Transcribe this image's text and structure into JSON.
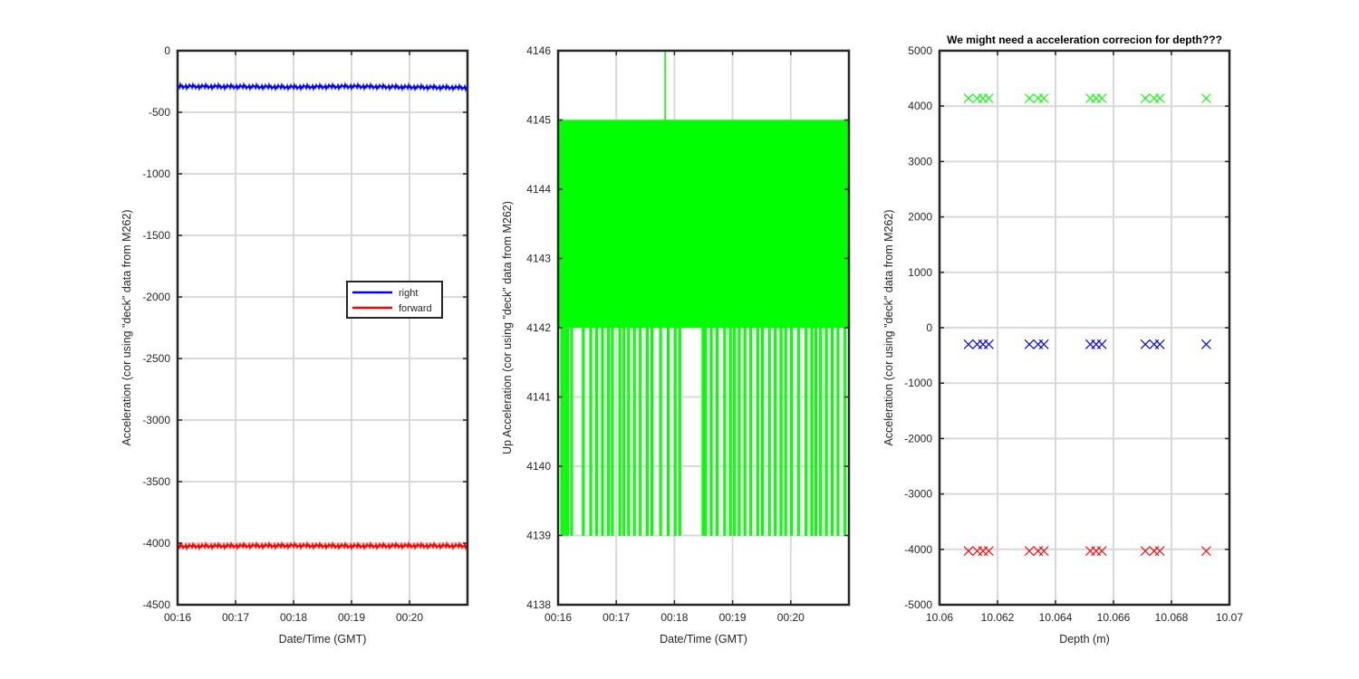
{
  "chart_data": [
    {
      "type": "line",
      "title": "",
      "xlabel": "Date/Time (GMT)",
      "ylabel": "Acceleration (cor using \"deck\" data from M262)",
      "x_tick_labels": [
        "00:16",
        "00:17",
        "00:18",
        "00:19",
        "00:20"
      ],
      "xlim_minutes": [
        16,
        21
      ],
      "x_ticks_minutes": [
        16,
        17,
        18,
        19,
        20
      ],
      "ylim": [
        -4500,
        0
      ],
      "y_ticks": [
        0,
        -500,
        -1000,
        -1500,
        -2000,
        -2500,
        -3000,
        -3500,
        -4000,
        -4500
      ],
      "grid": true,
      "legend": {
        "placement": "center-right",
        "entries": [
          "right",
          "forward"
        ]
      },
      "series": [
        {
          "name": "right",
          "color": "#0000ff",
          "x_minutes": [
            16,
            17,
            18,
            19,
            20,
            21
          ],
          "values": [
            -290,
            -292,
            -295,
            -290,
            -296,
            -300
          ]
        },
        {
          "name": "forward",
          "color": "#ff0000",
          "x_minutes": [
            16,
            17,
            18,
            19,
            20,
            21
          ],
          "values": [
            -4025,
            -4022,
            -4020,
            -4023,
            -4021,
            -4022
          ]
        }
      ]
    },
    {
      "type": "line",
      "title": "",
      "xlabel": "Date/Time (GMT)",
      "ylabel": "Up Acceleration (cor using \"deck\" data from M262)",
      "x_tick_labels": [
        "00:16",
        "00:17",
        "00:18",
        "00:19",
        "00:20"
      ],
      "xlim_minutes": [
        16,
        21
      ],
      "x_ticks_minutes": [
        16,
        17,
        18,
        19,
        20
      ],
      "ylim": [
        4138,
        4146
      ],
      "y_ticks": [
        4138,
        4139,
        4140,
        4141,
        4142,
        4143,
        4144,
        4145,
        4146
      ],
      "grid": true,
      "series": [
        {
          "name": "",
          "color": "#00ff00",
          "range_values": [
            4142,
            4145
          ],
          "high_spikes": [
            17.84
          ],
          "low_spikes": [
            16.05,
            16.1,
            16.15,
            16.22,
            16.42,
            16.55,
            16.65,
            16.75,
            16.85,
            16.92,
            17.05,
            17.12,
            17.2,
            17.3,
            17.4,
            17.52,
            17.6,
            17.75,
            17.88,
            18.0,
            18.08,
            18.48,
            18.52,
            18.62,
            18.72,
            18.85,
            18.95,
            19.02,
            19.1,
            19.2,
            19.3,
            19.42,
            19.5,
            19.62,
            19.72,
            19.82,
            19.9,
            20.0,
            20.12,
            20.25,
            20.35,
            20.42,
            20.5,
            20.6,
            20.7,
            20.8,
            20.92
          ]
        }
      ]
    },
    {
      "type": "scatter",
      "title": "We might need a acceleration correcion for depth???",
      "xlabel": "Depth (m)",
      "ylabel": "Acceleration (cor using \"deck\" data from M262)",
      "x_tick_labels": [
        "10.06",
        "10.062",
        "10.064",
        "10.066",
        "10.068",
        "10.07"
      ],
      "xlim": [
        10.06,
        10.07
      ],
      "x_ticks": [
        10.06,
        10.062,
        10.064,
        10.066,
        10.068,
        10.07
      ],
      "ylim": [
        -5000,
        5000
      ],
      "y_ticks": [
        5000,
        4000,
        3000,
        2000,
        1000,
        0,
        -1000,
        -2000,
        -3000,
        -4000,
        -5000
      ],
      "grid": true,
      "marker": "x",
      "depths": [
        10.061,
        10.0613,
        10.0615,
        10.0617,
        10.0631,
        10.0634,
        10.0636,
        10.0652,
        10.0654,
        10.0656,
        10.0671,
        10.0674,
        10.0676,
        10.0692
      ],
      "series": [
        {
          "name": "",
          "color": "#00ff00",
          "value": 4140
        },
        {
          "name": "",
          "color": "#0000ff",
          "value": -300
        },
        {
          "name": "",
          "color": "#ff0000",
          "value": -4030
        }
      ]
    }
  ]
}
